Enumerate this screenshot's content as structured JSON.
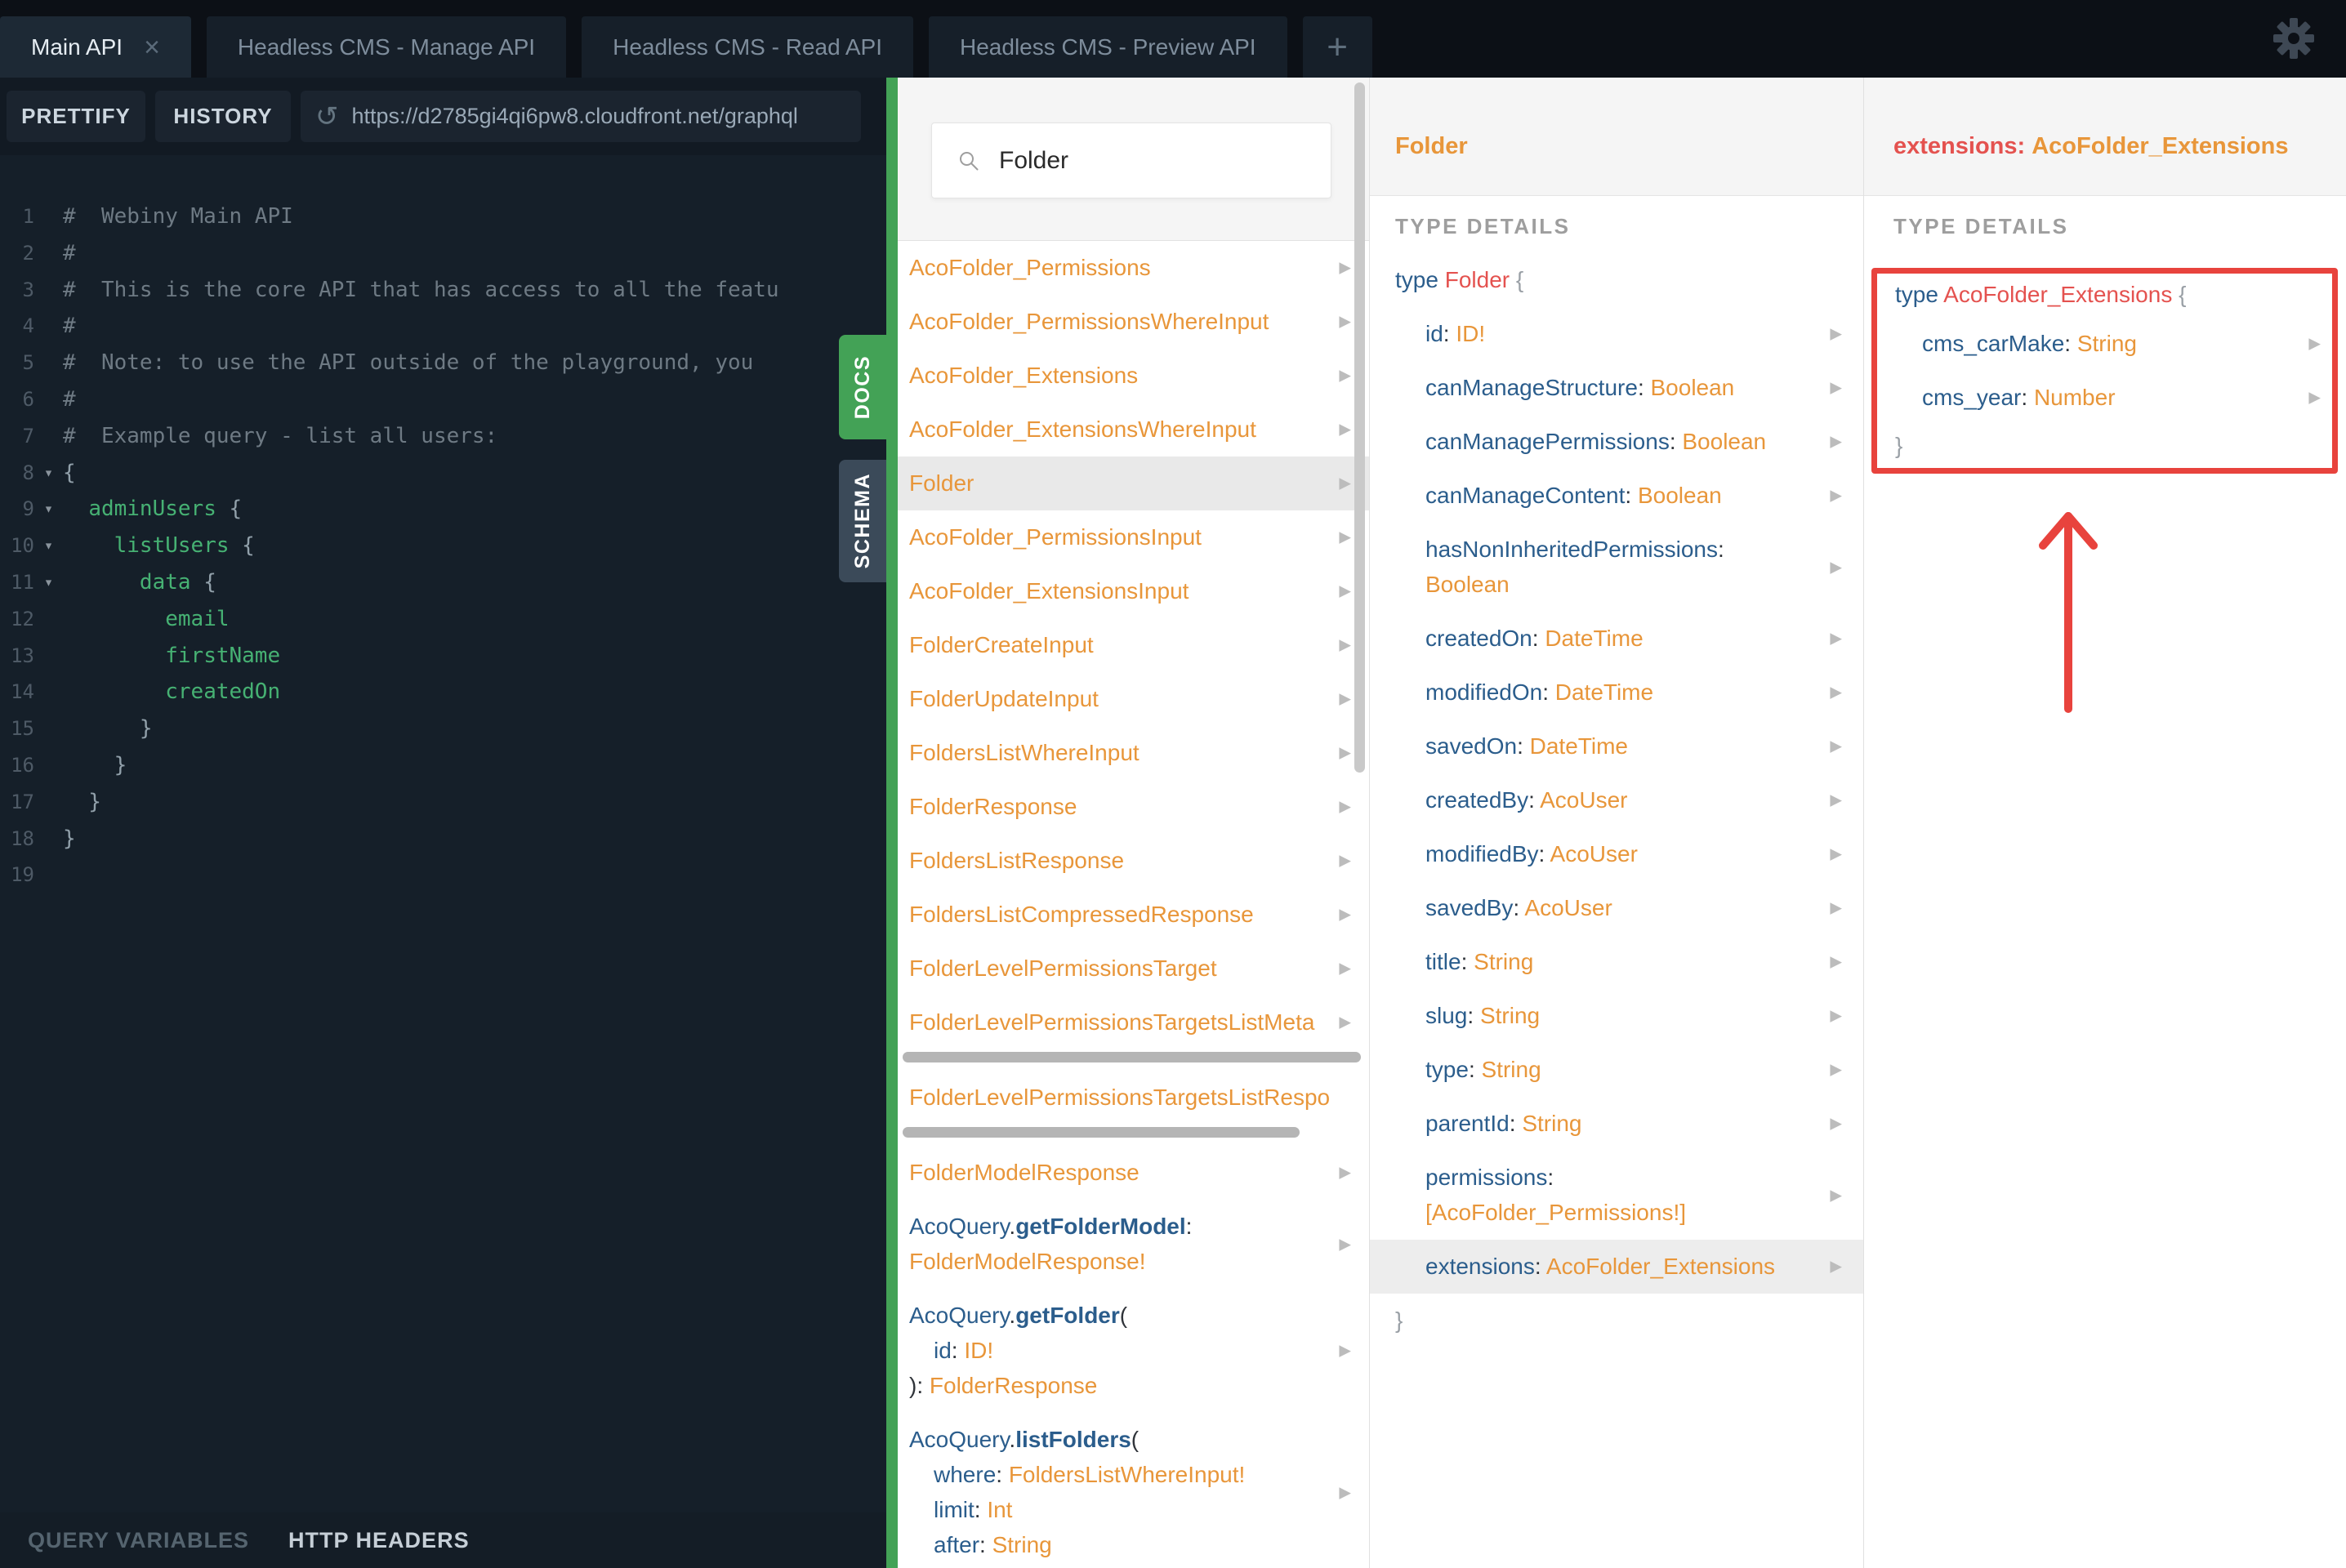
{
  "colors": {
    "accent_green": "#43a256",
    "type_orange": "#e8963a",
    "field_blue": "#2b5d8c",
    "name_coral": "#e4524f",
    "annotation_red": "#e8433d"
  },
  "tabs": {
    "items": [
      {
        "label": "Main API",
        "active": 1,
        "close": 1
      },
      {
        "label": "Headless CMS - Manage API"
      },
      {
        "label": "Headless CMS - Read API"
      },
      {
        "label": "Headless CMS - Preview API"
      }
    ],
    "add_label": "+"
  },
  "toolbar": {
    "prettify": "PRETTIFY",
    "history": "HISTORY",
    "url": "https://d2785gi4qi6pw8.cloudfront.net/graphql"
  },
  "bottom_bar": {
    "query_variables": "QUERY VARIABLES",
    "http_headers": "HTTP HEADERS"
  },
  "side_tabs": {
    "docs": "DOCS",
    "schema": "SCHEMA"
  },
  "editor": {
    "lines": [
      {
        "n": 1,
        "fold": 0,
        "s": [
          [
            "#  Webiny Main API",
            "cm"
          ]
        ]
      },
      {
        "n": 2,
        "fold": 0,
        "s": [
          [
            "#",
            "cm"
          ]
        ]
      },
      {
        "n": 3,
        "fold": 0,
        "s": [
          [
            "#  This is the core API that has access to all the featu",
            "cm"
          ]
        ]
      },
      {
        "n": 4,
        "fold": 0,
        "s": [
          [
            "#",
            "cm"
          ]
        ]
      },
      {
        "n": 5,
        "fold": 0,
        "s": [
          [
            "#  Note: to use the API outside of the playground, you",
            "cm"
          ]
        ]
      },
      {
        "n": 6,
        "fold": 0,
        "s": [
          [
            "#",
            "cm"
          ]
        ]
      },
      {
        "n": 7,
        "fold": 0,
        "s": [
          [
            "#  Example query - list all users:",
            "cm"
          ]
        ]
      },
      {
        "n": 8,
        "fold": 1,
        "s": [
          [
            "{",
            "pt"
          ]
        ]
      },
      {
        "n": 9,
        "fold": 1,
        "s": [
          [
            "  ",
            "pt"
          ],
          [
            "adminUsers",
            "fd"
          ],
          [
            " {",
            "pt"
          ]
        ]
      },
      {
        "n": 10,
        "fold": 1,
        "s": [
          [
            "    ",
            "pt"
          ],
          [
            "listUsers",
            "fd"
          ],
          [
            " {",
            "pt"
          ]
        ]
      },
      {
        "n": 11,
        "fold": 1,
        "s": [
          [
            "      ",
            "pt"
          ],
          [
            "data",
            "fd"
          ],
          [
            " {",
            "pt"
          ]
        ]
      },
      {
        "n": 12,
        "fold": 0,
        "s": [
          [
            "        ",
            "pt"
          ],
          [
            "email",
            "fd"
          ]
        ]
      },
      {
        "n": 13,
        "fold": 0,
        "s": [
          [
            "        ",
            "pt"
          ],
          [
            "firstName",
            "fd"
          ]
        ]
      },
      {
        "n": 14,
        "fold": 0,
        "s": [
          [
            "        ",
            "pt"
          ],
          [
            "createdOn",
            "fd"
          ]
        ]
      },
      {
        "n": 15,
        "fold": 0,
        "s": [
          [
            "      }",
            "pt"
          ]
        ]
      },
      {
        "n": 16,
        "fold": 0,
        "s": [
          [
            "    }",
            "pt"
          ]
        ]
      },
      {
        "n": 17,
        "fold": 0,
        "s": [
          [
            "  }",
            "pt"
          ]
        ]
      },
      {
        "n": 18,
        "fold": 0,
        "s": [
          [
            "}",
            "pt"
          ]
        ]
      },
      {
        "n": 19,
        "fold": 0,
        "s": []
      }
    ]
  },
  "docs_panel": {
    "search_value": "Folder",
    "items": [
      {
        "lines": [
          {
            "i": 0,
            "s": [
              [
                "AcoFolder_Permissions",
                "or"
              ]
            ]
          }
        ],
        "arrow": 1
      },
      {
        "lines": [
          {
            "i": 0,
            "s": [
              [
                "AcoFolder_PermissionsWhereInput",
                "or"
              ]
            ]
          }
        ],
        "arrow": 1
      },
      {
        "lines": [
          {
            "i": 0,
            "s": [
              [
                "AcoFolder_Extensions",
                "or"
              ]
            ]
          }
        ],
        "arrow": 1
      },
      {
        "lines": [
          {
            "i": 0,
            "s": [
              [
                "AcoFolder_ExtensionsWhereInput",
                "or"
              ]
            ]
          }
        ],
        "arrow": 1
      },
      {
        "lines": [
          {
            "i": 0,
            "s": [
              [
                "Folder",
                "or"
              ]
            ]
          }
        ],
        "arrow": 1,
        "sel": 1
      },
      {
        "lines": [
          {
            "i": 0,
            "s": [
              [
                "AcoFolder_PermissionsInput",
                "or"
              ]
            ]
          }
        ],
        "arrow": 1
      },
      {
        "lines": [
          {
            "i": 0,
            "s": [
              [
                "AcoFolder_ExtensionsInput",
                "or"
              ]
            ]
          }
        ],
        "arrow": 1
      },
      {
        "lines": [
          {
            "i": 0,
            "s": [
              [
                "FolderCreateInput",
                "or"
              ]
            ]
          }
        ],
        "arrow": 1
      },
      {
        "lines": [
          {
            "i": 0,
            "s": [
              [
                "FolderUpdateInput",
                "or"
              ]
            ]
          }
        ],
        "arrow": 1
      },
      {
        "lines": [
          {
            "i": 0,
            "s": [
              [
                "FoldersListWhereInput",
                "or"
              ]
            ]
          }
        ],
        "arrow": 1
      },
      {
        "lines": [
          {
            "i": 0,
            "s": [
              [
                "FolderResponse",
                "or"
              ]
            ]
          }
        ],
        "arrow": 1
      },
      {
        "lines": [
          {
            "i": 0,
            "s": [
              [
                "FoldersListResponse",
                "or"
              ]
            ]
          }
        ],
        "arrow": 1
      },
      {
        "lines": [
          {
            "i": 0,
            "s": [
              [
                "FoldersListCompressedResponse",
                "or"
              ]
            ]
          }
        ],
        "arrow": 1
      },
      {
        "lines": [
          {
            "i": 0,
            "s": [
              [
                "FolderLevelPermissionsTarget",
                "or"
              ]
            ]
          }
        ],
        "arrow": 1
      },
      {
        "lines": [
          {
            "i": 0,
            "s": [
              [
                "FolderLevelPermissionsTargetsListMeta",
                "or"
              ]
            ]
          }
        ],
        "arrow": 1,
        "hscroll": 1
      },
      {
        "lines": [
          {
            "i": 0,
            "s": [
              [
                "FolderLevelPermissionsTargetsListRespo",
                "or"
              ]
            ]
          }
        ],
        "arrow": 0,
        "hscroll": 1,
        "hshort": 1
      },
      {
        "lines": [
          {
            "i": 0,
            "s": [
              [
                "FolderModelResponse",
                "or"
              ]
            ]
          }
        ],
        "arrow": 1
      },
      {
        "lines": [
          {
            "i": 0,
            "s": [
              [
                "AcoQuery",
                "bl"
              ],
              [
                ".",
                "dk"
              ],
              [
                "getFolderModel",
                "bb"
              ],
              [
                ":",
                "dk"
              ]
            ]
          },
          {
            "i": 0,
            "s": [
              [
                "FolderModelResponse!",
                "or"
              ]
            ]
          }
        ],
        "arrow": 1
      },
      {
        "lines": [
          {
            "i": 0,
            "s": [
              [
                "AcoQuery",
                "bl"
              ],
              [
                ".",
                "dk"
              ],
              [
                "getFolder",
                "bb"
              ],
              [
                "(",
                "dk"
              ]
            ]
          },
          {
            "i": 1,
            "s": [
              [
                "id",
                "bl"
              ],
              [
                ": ",
                "dk"
              ],
              [
                "ID!",
                "or"
              ]
            ]
          },
          {
            "i": 0,
            "s": [
              [
                "): ",
                "dk"
              ],
              [
                "FolderResponse",
                "or"
              ]
            ]
          }
        ],
        "arrow": 1
      },
      {
        "lines": [
          {
            "i": 0,
            "s": [
              [
                "AcoQuery",
                "bl"
              ],
              [
                ".",
                "dk"
              ],
              [
                "listFolders",
                "bb"
              ],
              [
                "(",
                "dk"
              ]
            ]
          },
          {
            "i": 1,
            "s": [
              [
                "where",
                "bl"
              ],
              [
                ": ",
                "dk"
              ],
              [
                "FoldersListWhereInput!",
                "or"
              ]
            ]
          },
          {
            "i": 1,
            "s": [
              [
                "limit",
                "bl"
              ],
              [
                ": ",
                "dk"
              ],
              [
                "Int",
                "or"
              ]
            ]
          },
          {
            "i": 1,
            "s": [
              [
                "after",
                "bl"
              ],
              [
                ": ",
                "dk"
              ],
              [
                "String",
                "or"
              ]
            ]
          }
        ],
        "arrow": 1
      }
    ]
  },
  "type_panel": {
    "title": "Folder",
    "section": "TYPE DETAILS",
    "rows": [
      {
        "cls": "open",
        "lines": [
          [
            [
              "type",
              "bl"
            ],
            [
              " ",
              "dk"
            ],
            [
              "Folder",
              "cr"
            ],
            [
              " {",
              "gy"
            ]
          ]
        ]
      },
      {
        "lines": [
          [
            [
              "id",
              "bl"
            ],
            [
              ": ",
              "dk"
            ],
            [
              "ID!",
              "or"
            ]
          ]
        ],
        "arrow": 1
      },
      {
        "lines": [
          [
            [
              "canManageStructure",
              "bl"
            ],
            [
              ": ",
              "dk"
            ],
            [
              "Boolean",
              "or"
            ]
          ]
        ],
        "arrow": 1
      },
      {
        "lines": [
          [
            [
              "canManagePermissions",
              "bl"
            ],
            [
              ": ",
              "dk"
            ],
            [
              "Boolean",
              "or"
            ]
          ]
        ],
        "arrow": 1
      },
      {
        "lines": [
          [
            [
              "canManageContent",
              "bl"
            ],
            [
              ": ",
              "dk"
            ],
            [
              "Boolean",
              "or"
            ]
          ]
        ],
        "arrow": 1
      },
      {
        "lines": [
          [
            [
              "hasNonInheritedPermissions",
              "bl"
            ],
            [
              ":",
              "dk"
            ]
          ],
          [
            [
              "Boolean",
              "or"
            ]
          ]
        ],
        "arrow": 1
      },
      {
        "lines": [
          [
            [
              "createdOn",
              "bl"
            ],
            [
              ": ",
              "dk"
            ],
            [
              "DateTime",
              "or"
            ]
          ]
        ],
        "arrow": 1
      },
      {
        "lines": [
          [
            [
              "modifiedOn",
              "bl"
            ],
            [
              ": ",
              "dk"
            ],
            [
              "DateTime",
              "or"
            ]
          ]
        ],
        "arrow": 1
      },
      {
        "lines": [
          [
            [
              "savedOn",
              "bl"
            ],
            [
              ": ",
              "dk"
            ],
            [
              "DateTime",
              "or"
            ]
          ]
        ],
        "arrow": 1
      },
      {
        "lines": [
          [
            [
              "createdBy",
              "bl"
            ],
            [
              ": ",
              "dk"
            ],
            [
              "AcoUser",
              "or"
            ]
          ]
        ],
        "arrow": 1
      },
      {
        "lines": [
          [
            [
              "modifiedBy",
              "bl"
            ],
            [
              ": ",
              "dk"
            ],
            [
              "AcoUser",
              "or"
            ]
          ]
        ],
        "arrow": 1
      },
      {
        "lines": [
          [
            [
              "savedBy",
              "bl"
            ],
            [
              ": ",
              "dk"
            ],
            [
              "AcoUser",
              "or"
            ]
          ]
        ],
        "arrow": 1
      },
      {
        "lines": [
          [
            [
              "title",
              "bl"
            ],
            [
              ": ",
              "dk"
            ],
            [
              "String",
              "or"
            ]
          ]
        ],
        "arrow": 1
      },
      {
        "lines": [
          [
            [
              "slug",
              "bl"
            ],
            [
              ": ",
              "dk"
            ],
            [
              "String",
              "or"
            ]
          ]
        ],
        "arrow": 1
      },
      {
        "lines": [
          [
            [
              "type",
              "bl"
            ],
            [
              ": ",
              "dk"
            ],
            [
              "String",
              "or"
            ]
          ]
        ],
        "arrow": 1
      },
      {
        "lines": [
          [
            [
              "parentId",
              "bl"
            ],
            [
              ": ",
              "dk"
            ],
            [
              "String",
              "or"
            ]
          ]
        ],
        "arrow": 1
      },
      {
        "lines": [
          [
            [
              "permissions",
              "bl"
            ],
            [
              ":",
              "dk"
            ]
          ],
          [
            [
              "[AcoFolder_Permissions!]",
              "or"
            ]
          ]
        ],
        "arrow": 1
      },
      {
        "lines": [
          [
            [
              "extensions",
              "bl"
            ],
            [
              ": ",
              "dk"
            ],
            [
              "AcoFolder_Extensions",
              "or"
            ]
          ]
        ],
        "arrow": 1,
        "sel": 1
      },
      {
        "cls": "close",
        "lines": [
          [
            [
              "}",
              "gy"
            ]
          ]
        ]
      }
    ]
  },
  "extensions_panel": {
    "title_field": "extensions:",
    "title_type": "AcoFolder_Extensions",
    "section": "TYPE DETAILS",
    "rows": [
      {
        "cls": "open",
        "lines": [
          [
            [
              "type",
              "bl"
            ],
            [
              " ",
              "dk"
            ],
            [
              "AcoFolder_Extensions",
              "cr"
            ],
            [
              " {",
              "gy"
            ]
          ]
        ]
      },
      {
        "lines": [
          [
            [
              "cms_carMake",
              "bl"
            ],
            [
              ": ",
              "dk"
            ],
            [
              "String",
              "or"
            ]
          ]
        ],
        "arrow": 1
      },
      {
        "lines": [
          [
            [
              "cms_year",
              "bl"
            ],
            [
              ": ",
              "dk"
            ],
            [
              "Number",
              "or"
            ]
          ]
        ],
        "arrow": 1
      },
      {
        "cls": "close",
        "lines": [
          [
            [
              "}",
              "gy"
            ]
          ]
        ]
      }
    ]
  }
}
